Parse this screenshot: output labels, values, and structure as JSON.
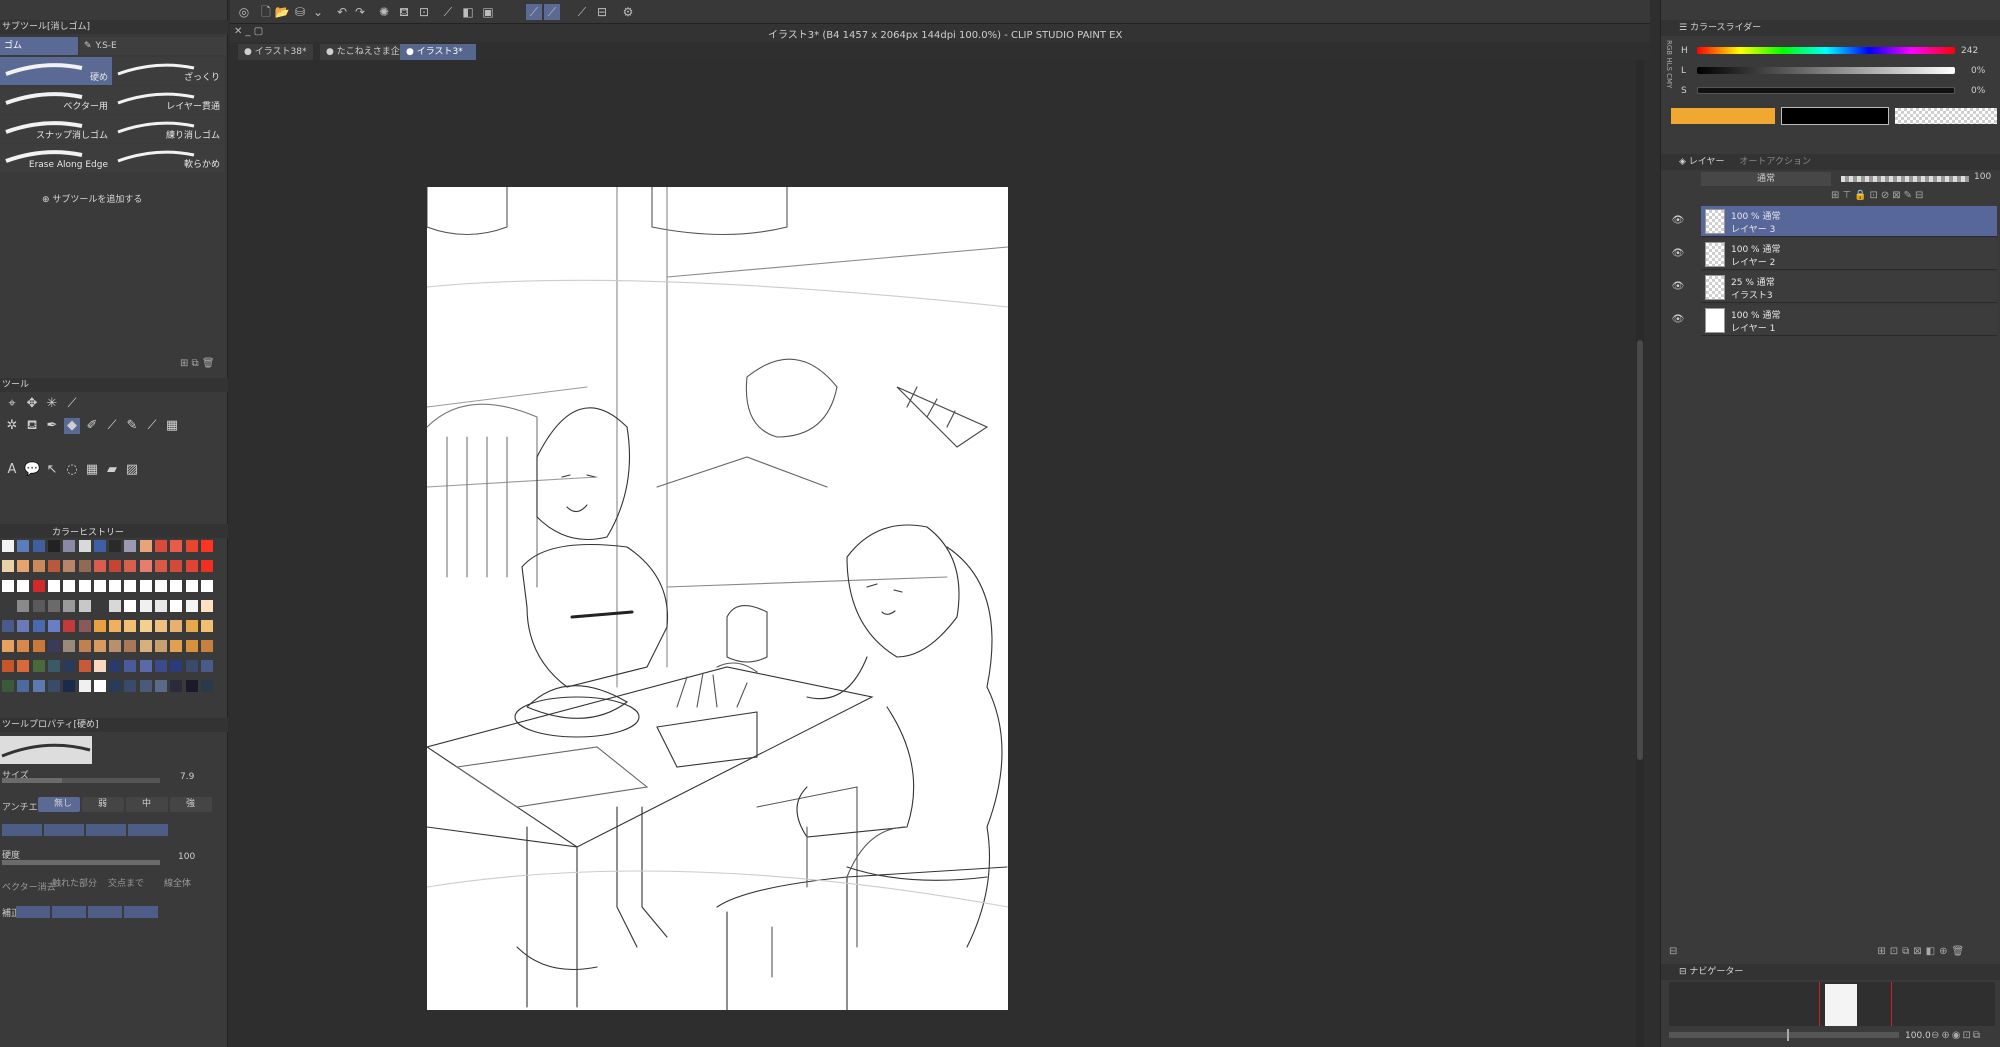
{
  "app": {
    "title": "イラスト3* (B4 1457 x 2064px 144dpi 100.0%)  - CLIP STUDIO PAINT EX"
  },
  "doc_tabs": [
    {
      "label": "イラスト38*"
    },
    {
      "label": "たこねえさま企"
    },
    {
      "label": "イラスト3*"
    }
  ],
  "subtool": {
    "panel_title": "サブツール[消しゴム]",
    "tab_left": "ゴム",
    "tab_right": "Y.S-E",
    "brushes": [
      {
        "label": "硬め"
      },
      {
        "label": "ざっくり"
      },
      {
        "label": "ベクター用"
      },
      {
        "label": "レイヤー貫通"
      },
      {
        "label": "スナップ消しゴム"
      },
      {
        "label": "練り消しゴム"
      },
      {
        "label": "Erase Along Edge"
      },
      {
        "label": "軟らかめ"
      }
    ],
    "add_label": "サブツールを追加する"
  },
  "tools": {
    "panel_title": "ツール"
  },
  "color_history": {
    "tab_label": "カラーヒストリー",
    "swatches": [
      "#f2f2f2",
      "#5b7dbe",
      "#3f5fa0",
      "#222222",
      "#8a8aa5",
      "#d9d9d9",
      "#3e5fa5",
      "#2a2a2a",
      "#9a9ab0",
      "#e8a37a",
      "#d94a3a",
      "#e85a4a",
      "#e8452e",
      "#ff3322",
      "#e8d2a8",
      "#e6a46c",
      "#c88a5a",
      "#b85a3a",
      "#b8846a",
      "#8f6b54",
      "#d85d4e",
      "#c44436",
      "#d6604c",
      "#e67e6e",
      "#d85a46",
      "#d14a3a",
      "#e04432",
      "#f02e22",
      "#ffffff",
      "#ffffff",
      "#d22a2a",
      "#ffffff",
      "#ffffff",
      "#ffffff",
      "#ffffff",
      "#ffffff",
      "#ffffff",
      "#ffffff",
      "#ffffff",
      "#ffffff",
      "#ffffff",
      "#ffffff",
      "#3a3a3a",
      "#8a8a8a",
      "#5a5a5a",
      "#6a6a6a",
      "#9a9a9a",
      "#c8c8c8",
      "#3a3a3a",
      "#d8d8d8",
      "#ffffff",
      "#f0f0f0",
      "#e8e8e8",
      "#ffffff",
      "#f4f4f4",
      "#ffe0c0",
      "#4a5a8a",
      "#6a7ab8",
      "#4a6ab0",
      "#6a7ec8",
      "#c43a3a",
      "#8a5a5a",
      "#e8a040",
      "#f0b060",
      "#f2c070",
      "#f4d090",
      "#f0c080",
      "#e8b070",
      "#e6a848",
      "#f0c070",
      "#e8a060",
      "#d88848",
      "#c87838",
      "#3a3a5a",
      "#9a8a7a",
      "#c08050",
      "#d89a60",
      "#b89070",
      "#a87858",
      "#d8b080",
      "#c8a070",
      "#e0a050",
      "#d8903a",
      "#c88040",
      "#c8552a",
      "#d86a3a",
      "#4a6a3a",
      "#3a5a6a",
      "#2a3a5a",
      "#c85a3a",
      "#f8d8c0",
      "#2a3a6a",
      "#4a5a9a",
      "#5a6aa8",
      "#3a4a8a",
      "#2a3a7a",
      "#3a4a6a",
      "#4a5a8a",
      "#3a5a3a",
      "#4a6aa0",
      "#5a7ab0",
      "#3a4a6a",
      "#1a2a4a",
      "#f0f0f0",
      "#ffffff",
      "#2a3a5a",
      "#3a4a6a",
      "#4a5a7a",
      "#5a6a8a",
      "#2a2a3a",
      "#1a1a2a",
      "#2a3a4a"
    ]
  },
  "tool_property": {
    "panel_title": "ツールプロパティ[硬め]",
    "size_label": "サイズ",
    "size_value": "7.9",
    "antialias_label": "アンチエイリアス",
    "aa_options": [
      {
        "label": "無し"
      },
      {
        "label": "弱"
      },
      {
        "label": "中"
      },
      {
        "label": "強"
      }
    ],
    "density_label": "硬度",
    "density_value": "100",
    "vector_erase_label": "ベクター消去",
    "vector_opts": [
      {
        "label": "触れた部分"
      },
      {
        "label": "交点まで"
      },
      {
        "label": "線全体"
      }
    ],
    "correction_label": "補正"
  },
  "color_slider": {
    "panel_title": "カラースライダー",
    "h_label": "H",
    "h_value": "242",
    "l_label": "L",
    "l_value": "0%",
    "s_label": "S",
    "s_value": "0%",
    "main_color": "#f0a830",
    "sub_color": "#000000",
    "vertical_tabs": "RGB HLS CMY"
  },
  "layers": {
    "panel_title": "レイヤー",
    "second_tab": "オートアクション",
    "blend_mode": "通常",
    "opacity": "100",
    "items": [
      {
        "l1": "100 %  通常",
        "l2": "レイヤー 3",
        "selected": true,
        "thumb": "checker"
      },
      {
        "l1": "100 %  通常",
        "l2": "レイヤー 2",
        "selected": false,
        "thumb": "checker"
      },
      {
        "l1": "25 %  通常",
        "l2": "イラスト3",
        "selected": false,
        "thumb": "checker"
      },
      {
        "l1": "100 %  通常",
        "l2": "レイヤー 1",
        "selected": false,
        "thumb": "white"
      }
    ]
  },
  "navigator": {
    "panel_title": "ナビゲーター",
    "zoom": "100.0"
  }
}
